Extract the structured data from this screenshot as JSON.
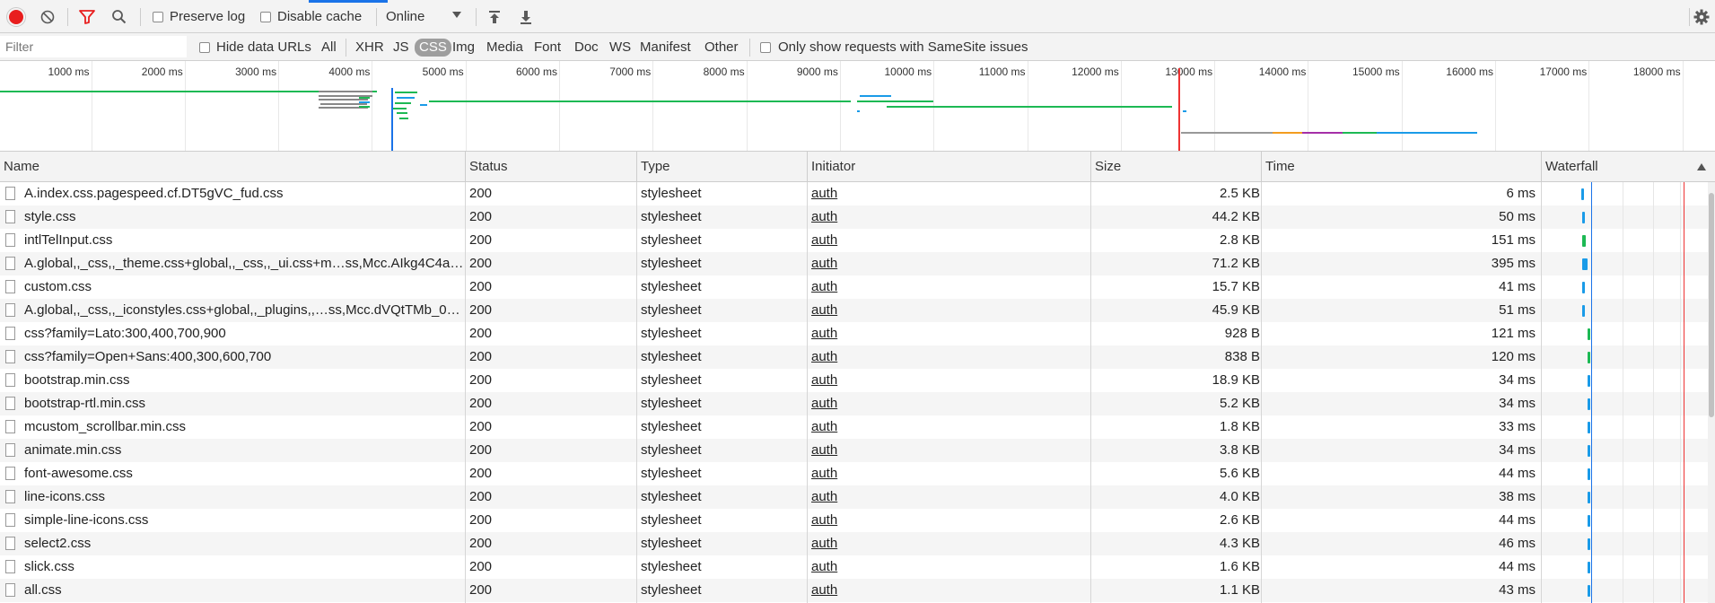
{
  "toolbar": {
    "preserve_log": "Preserve log",
    "disable_cache": "Disable cache",
    "throttle": "Online",
    "icons": [
      "record-icon",
      "clear-icon",
      "filter-icon",
      "search-icon",
      "upload-icon",
      "download-icon",
      "settings-gear-icon"
    ]
  },
  "filterbar": {
    "placeholder": "Filter",
    "hide_data_urls": "Hide data URLs",
    "types": [
      "All",
      "XHR",
      "JS",
      "CSS",
      "Img",
      "Media",
      "Font",
      "Doc",
      "WS",
      "Manifest",
      "Other"
    ],
    "active_type": "CSS",
    "samesite": "Only show requests with SameSite issues"
  },
  "overview": {
    "ticks": [
      "1000 ms",
      "2000 ms",
      "3000 ms",
      "4000 ms",
      "5000 ms",
      "6000 ms",
      "7000 ms",
      "8000 ms",
      "9000 ms",
      "10000 ms",
      "11000 ms",
      "12000 ms",
      "13000 ms",
      "14000 ms",
      "15000 ms",
      "16000 ms",
      "17000 ms",
      "18000 ms"
    ]
  },
  "columns": {
    "name": "Name",
    "status": "Status",
    "type": "Type",
    "initiator": "Initiator",
    "size": "Size",
    "time": "Time",
    "waterfall": "Waterfall",
    "sort_icon": "sort-ascending-icon"
  },
  "rows": [
    {
      "name": "A.index.css.pagespeed.cf.DT5gVC_fud.css",
      "status": "200",
      "type": "stylesheet",
      "initiator": "auth",
      "size": "2.5 KB",
      "time": "6 ms"
    },
    {
      "name": "style.css",
      "status": "200",
      "type": "stylesheet",
      "initiator": "auth",
      "size": "44.2 KB",
      "time": "50 ms"
    },
    {
      "name": "intlTelInput.css",
      "status": "200",
      "type": "stylesheet",
      "initiator": "auth",
      "size": "2.8 KB",
      "time": "151 ms"
    },
    {
      "name": "A.global,,_css,,_theme.css+global,,_css,,_ui.css+m…ss,Mcc.AIkg4C4a_…",
      "status": "200",
      "type": "stylesheet",
      "initiator": "auth",
      "size": "71.2 KB",
      "time": "395 ms"
    },
    {
      "name": "custom.css",
      "status": "200",
      "type": "stylesheet",
      "initiator": "auth",
      "size": "15.7 KB",
      "time": "41 ms"
    },
    {
      "name": "A.global,,_css,,_iconstyles.css+global,,_plugins,,…ss,Mcc.dVQtTMb_0…",
      "status": "200",
      "type": "stylesheet",
      "initiator": "auth",
      "size": "45.9 KB",
      "time": "51 ms"
    },
    {
      "name": "css?family=Lato:300,400,700,900",
      "status": "200",
      "type": "stylesheet",
      "initiator": "auth",
      "size": "928 B",
      "time": "121 ms"
    },
    {
      "name": "css?family=Open+Sans:400,300,600,700",
      "status": "200",
      "type": "stylesheet",
      "initiator": "auth",
      "size": "838 B",
      "time": "120 ms"
    },
    {
      "name": "bootstrap.min.css",
      "status": "200",
      "type": "stylesheet",
      "initiator": "auth",
      "size": "18.9 KB",
      "time": "34 ms"
    },
    {
      "name": "bootstrap-rtl.min.css",
      "status": "200",
      "type": "stylesheet",
      "initiator": "auth",
      "size": "5.2 KB",
      "time": "34 ms"
    },
    {
      "name": "mcustom_scrollbar.min.css",
      "status": "200",
      "type": "stylesheet",
      "initiator": "auth",
      "size": "1.8 KB",
      "time": "33 ms"
    },
    {
      "name": "animate.min.css",
      "status": "200",
      "type": "stylesheet",
      "initiator": "auth",
      "size": "3.8 KB",
      "time": "34 ms"
    },
    {
      "name": "font-awesome.css",
      "status": "200",
      "type": "stylesheet",
      "initiator": "auth",
      "size": "5.6 KB",
      "time": "44 ms"
    },
    {
      "name": "line-icons.css",
      "status": "200",
      "type": "stylesheet",
      "initiator": "auth",
      "size": "4.0 KB",
      "time": "38 ms"
    },
    {
      "name": "simple-line-icons.css",
      "status": "200",
      "type": "stylesheet",
      "initiator": "auth",
      "size": "2.6 KB",
      "time": "44 ms"
    },
    {
      "name": "select2.css",
      "status": "200",
      "type": "stylesheet",
      "initiator": "auth",
      "size": "4.3 KB",
      "time": "46 ms"
    },
    {
      "name": "slick.css",
      "status": "200",
      "type": "stylesheet",
      "initiator": "auth",
      "size": "1.6 KB",
      "time": "44 ms"
    },
    {
      "name": "all.css",
      "status": "200",
      "type": "stylesheet",
      "initiator": "auth",
      "size": "1.1 KB",
      "time": "43 ms"
    }
  ],
  "colors": {
    "record": "#e81e1e",
    "filter_active": "#e81e1e",
    "waterfall_blue": "#1a9be8",
    "waterfall_green": "#1db954",
    "load_line": "#e33",
    "domcontent_line": "#1a73e8"
  }
}
